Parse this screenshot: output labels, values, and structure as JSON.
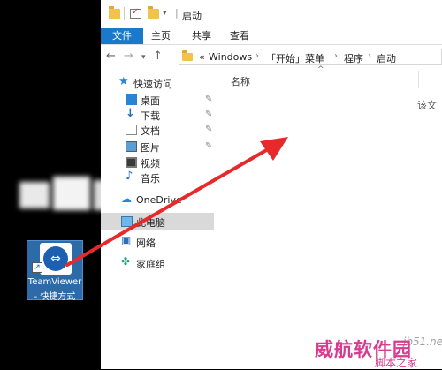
{
  "window": {
    "title": "启动",
    "ribbon_tabs": [
      "文件",
      "主页",
      "共享",
      "查看"
    ]
  },
  "address": {
    "crumbs": [
      "«",
      "Windows",
      "「开始」菜单",
      "程序",
      "启动"
    ]
  },
  "nav": {
    "items": [
      {
        "label": "快速访问",
        "icon": "star-icon",
        "pinned": false
      },
      {
        "label": "桌面",
        "icon": "desktop-icon",
        "pinned": true
      },
      {
        "label": "下载",
        "icon": "download-icon",
        "pinned": true
      },
      {
        "label": "文档",
        "icon": "document-icon",
        "pinned": true
      },
      {
        "label": "图片",
        "icon": "pictures-icon",
        "pinned": true
      },
      {
        "label": "视频",
        "icon": "video-icon",
        "pinned": false
      },
      {
        "label": "音乐",
        "icon": "music-icon",
        "pinned": false
      },
      {
        "label": "OneDrive",
        "icon": "cloud-icon",
        "pinned": false
      },
      {
        "label": "此电脑",
        "icon": "computer-icon",
        "pinned": false
      },
      {
        "label": "网络",
        "icon": "network-icon",
        "pinned": false
      },
      {
        "label": "家庭组",
        "icon": "homegroup-icon",
        "pinned": false
      }
    ]
  },
  "content": {
    "column_name": "名称",
    "empty_text": "该文"
  },
  "desktop": {
    "shortcut_label_line1": "TeamViewer",
    "shortcut_label_line2": "- 快捷方式"
  },
  "watermark": {
    "site": "jb51.net",
    "brand": "威航软件园",
    "sub": "脚本之家"
  },
  "colors": {
    "file_tab": "#1979ca",
    "arrow": "#e8292b",
    "watermark": "#d83c8f"
  }
}
